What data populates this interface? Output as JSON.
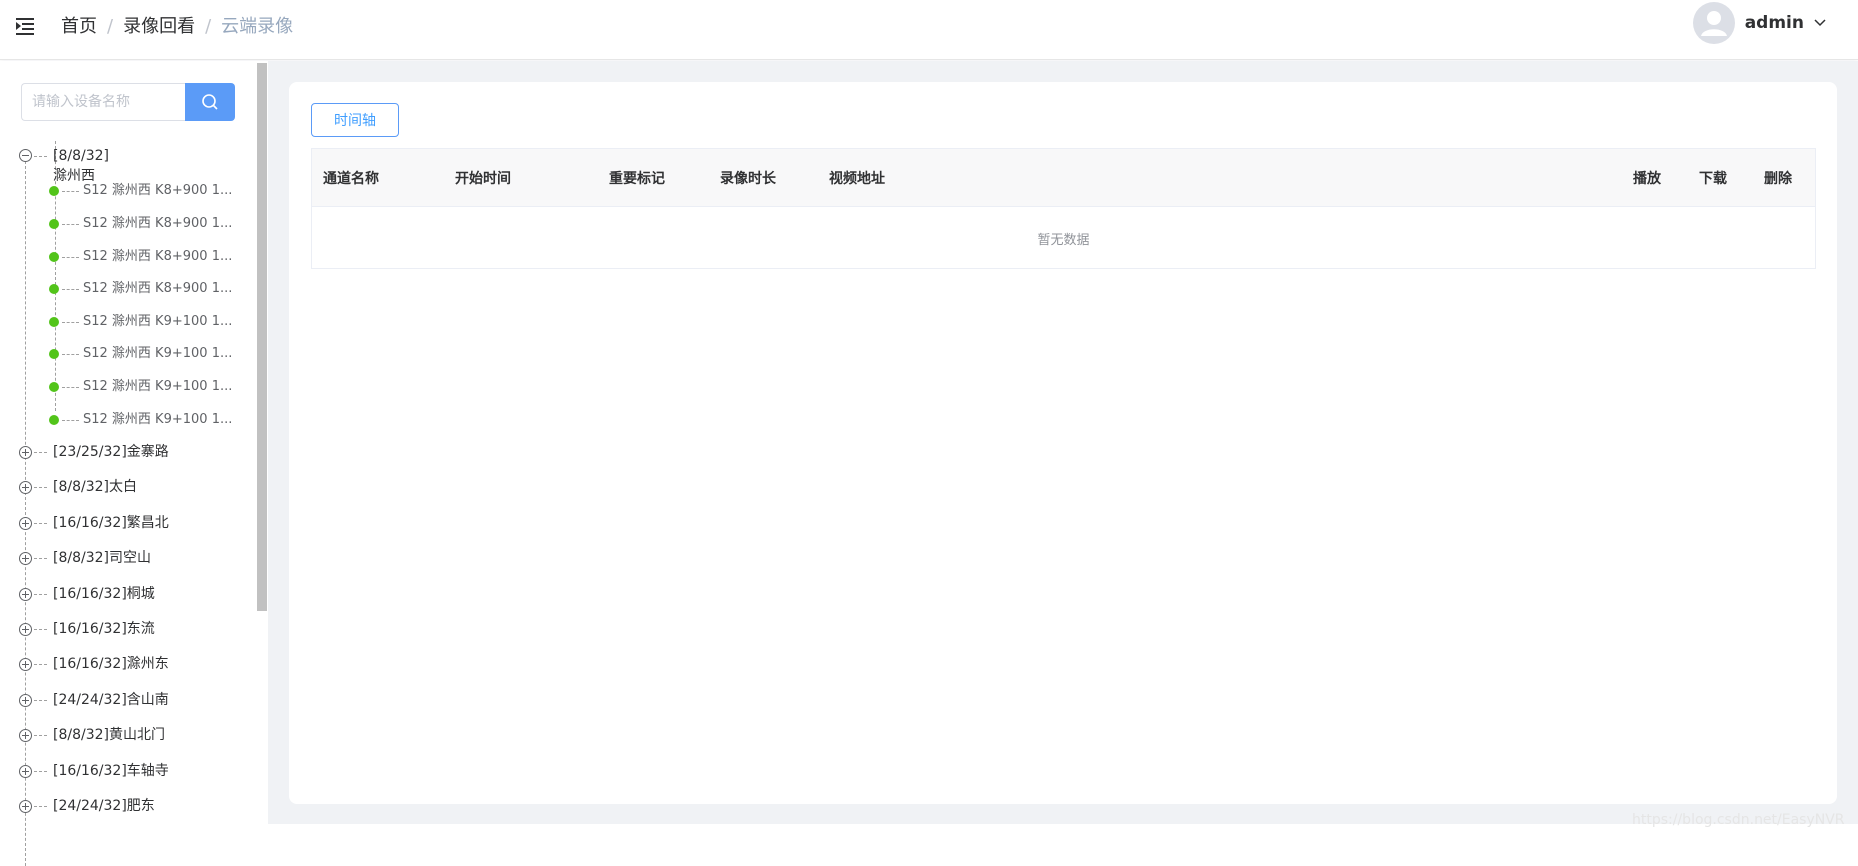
{
  "header": {
    "breadcrumb": [
      "首页",
      "录像回看",
      "云端录像"
    ],
    "breadcrumb_separator": "/",
    "username": "admin"
  },
  "sidebar": {
    "search_placeholder": "请输入设备名称",
    "tree": {
      "expanded": {
        "label": "[8/8/32]滁州西",
        "channels": [
          "S12 滁州西 K8+900 1...",
          "S12 滁州西 K8+900 1...",
          "S12 滁州西 K8+900 1...",
          "S12 滁州西 K8+900 1...",
          "S12 滁州西 K9+100 1...",
          "S12 滁州西 K9+100 1...",
          "S12 滁州西 K9+100 1...",
          "S12 滁州西 K9+100 1..."
        ]
      },
      "collapsed": [
        "[23/25/32]金寨路",
        "[8/8/32]太白",
        "[16/16/32]繁昌北",
        "[8/8/32]司空山",
        "[16/16/32]桐城",
        "[16/16/32]东流",
        "[16/16/32]滁州东",
        "[24/24/32]含山南",
        "[8/8/32]黄山北门",
        "[16/16/32]车轴寺",
        "[24/24/32]肥东"
      ]
    }
  },
  "main": {
    "timeline_button": "时间轴",
    "table": {
      "columns": [
        "通道名称",
        "开始时间",
        "重要标记",
        "录像时长",
        "视频地址",
        "播放",
        "下载",
        "删除"
      ],
      "empty_text": "暂无数据"
    }
  },
  "watermark": "https://blog.csdn.net/EasyNVR",
  "colors": {
    "accent": "#409eff",
    "online_dot": "#52c41a",
    "content_bg": "#f0f2f5"
  }
}
